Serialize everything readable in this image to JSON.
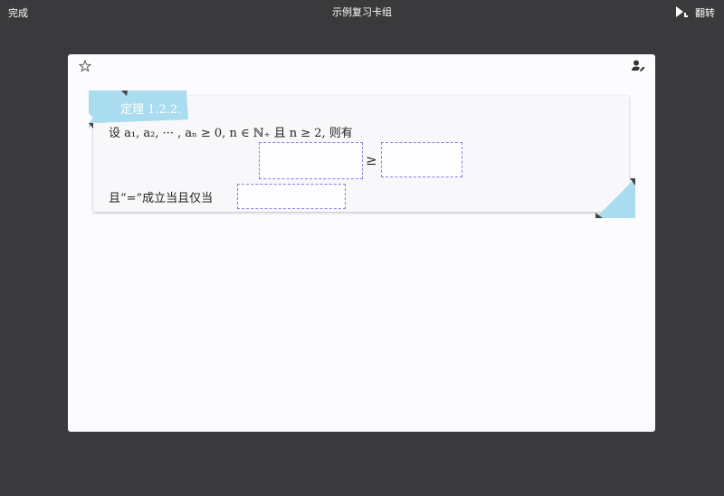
{
  "header": {
    "done_label": "完成",
    "title": "示例复习卡组",
    "flip_label": "翻转",
    "play_icon": "play-speaker-icon"
  },
  "card": {
    "star_icon": "star-icon",
    "user_edit_icon": "user-edit-icon",
    "theorem": {
      "label": "定理 1.2.2.",
      "line1": "设 a₁, a₂, ··· , aₙ ≥ 0, n ∈ ℕ₊ 且 n ≥ 2, 则有",
      "relation": "≥",
      "line3": "且“=”成立当且仅当"
    },
    "blanks": [
      "",
      "",
      ""
    ]
  },
  "colors": {
    "background": "#3a393b",
    "card": "#fcfcfe",
    "ribbon": "#a9dcef",
    "blank_border": "#8c7be0"
  }
}
